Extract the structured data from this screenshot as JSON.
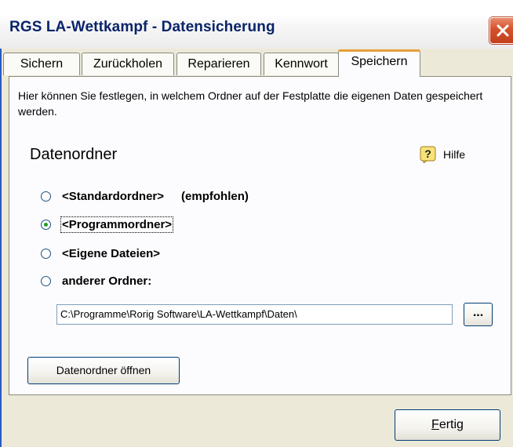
{
  "window": {
    "title": "RGS LA-Wettkampf - Datensicherung"
  },
  "tabs": [
    {
      "label": "Sichern"
    },
    {
      "label": "Zurückholen"
    },
    {
      "label": "Reparieren"
    },
    {
      "label": "Kennwort"
    },
    {
      "label": "Speichern"
    }
  ],
  "active_tab": "Speichern",
  "panel": {
    "description": "Hier können Sie festlegen, in welchem Ordner auf der Festplatte die eigenen Daten gespeichert werden.",
    "heading": "Datenordner",
    "help_label": "Hilfe",
    "options": [
      {
        "label": "<Standardordner>",
        "extra": "(empfohlen)",
        "selected": false
      },
      {
        "label": "<Programmordner>",
        "selected": true
      },
      {
        "label": "<Eigene Dateien>",
        "selected": false
      },
      {
        "label": "anderer Ordner:",
        "selected": false
      }
    ],
    "path_value": "C:\\Programme\\Rorig Software\\LA-Wettkampf\\Daten\\",
    "browse_label": "...",
    "open_folder_label": "Datenordner öffnen"
  },
  "footer": {
    "done_label_first": "F",
    "done_label_rest": "ertig"
  },
  "colors": {
    "title_text": "#0a246a",
    "close_button": "#d5512c",
    "active_tab_accent": "#e6a03c"
  },
  "icons": {
    "help": "question-mark-icon",
    "close": "close-icon"
  }
}
